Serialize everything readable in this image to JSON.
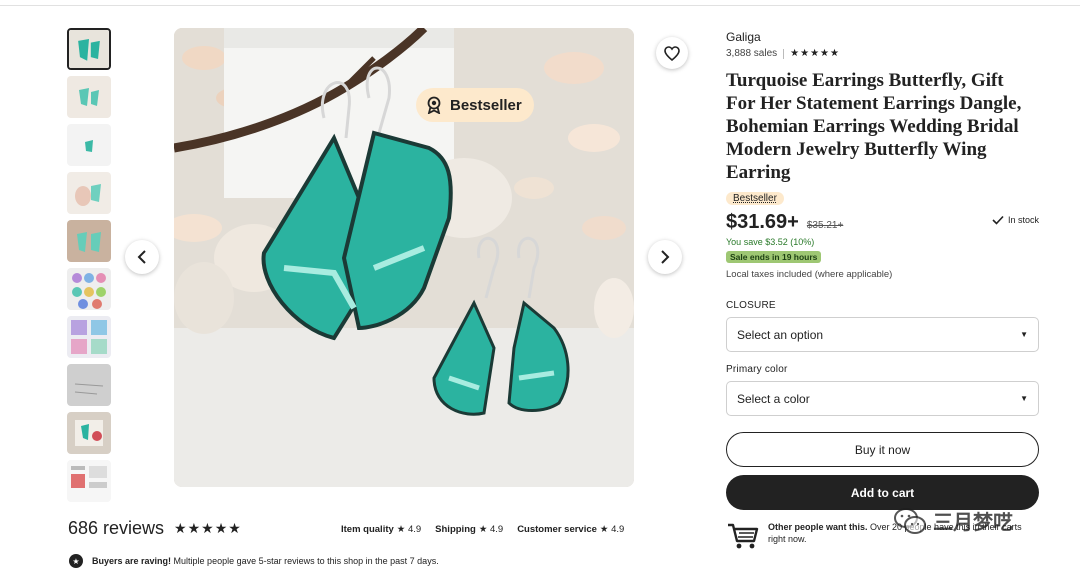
{
  "listing": {
    "badge": "Bestseller",
    "shop_name": "Galiga",
    "sales": "3,888 sales",
    "stars": "★★★★★",
    "title": "Turquoise Earrings Butterfly, Gift For Her Statement Earrings Dangle, Bohemian Earrings Wedding Bridal Modern Jewelry Butterfly Wing Earring",
    "pill": "Bestseller",
    "price": "$31.69+",
    "old_price": "$35.21+",
    "stock": "In stock",
    "save": "You save $3.52 (10%)",
    "sale_ends": "Sale ends in 19 hours",
    "taxes": "Local taxes included (where applicable)"
  },
  "options": {
    "closure_label": "CLOSURE",
    "closure_value": "Select an option",
    "color_label": "Primary color",
    "color_value": "Select a color"
  },
  "actions": {
    "buy_now": "Buy it now",
    "add_to_cart": "Add to cart"
  },
  "others": {
    "bold": "Other people want this.",
    "rest": " Over 20 people have this in their carts right now."
  },
  "reviews": {
    "count": "686 reviews",
    "stars": "★★★★★",
    "item_quality_label": "Item quality",
    "item_quality": "★ 4.9",
    "shipping_label": "Shipping",
    "shipping": "★ 4.9",
    "service_label": "Customer service",
    "service": "★ 4.9",
    "raving_bold": "Buyers are raving!",
    "raving_rest": " Multiple people gave 5-star reviews to this shop in the past 7 days."
  },
  "watermark": "三月梦呓",
  "icons": [
    "heart-icon",
    "chevron-left-icon",
    "chevron-right-icon",
    "ribbon-icon",
    "check-icon",
    "caret-down-icon",
    "cart-icon",
    "star-icon",
    "wechat-icon"
  ],
  "colors": {
    "accent_dark": "#222222",
    "badge_bg": "#fde9cc",
    "sale_green": "#9ec773",
    "save_green": "#2a7a2a",
    "turquoise": "#2bb3a0"
  }
}
